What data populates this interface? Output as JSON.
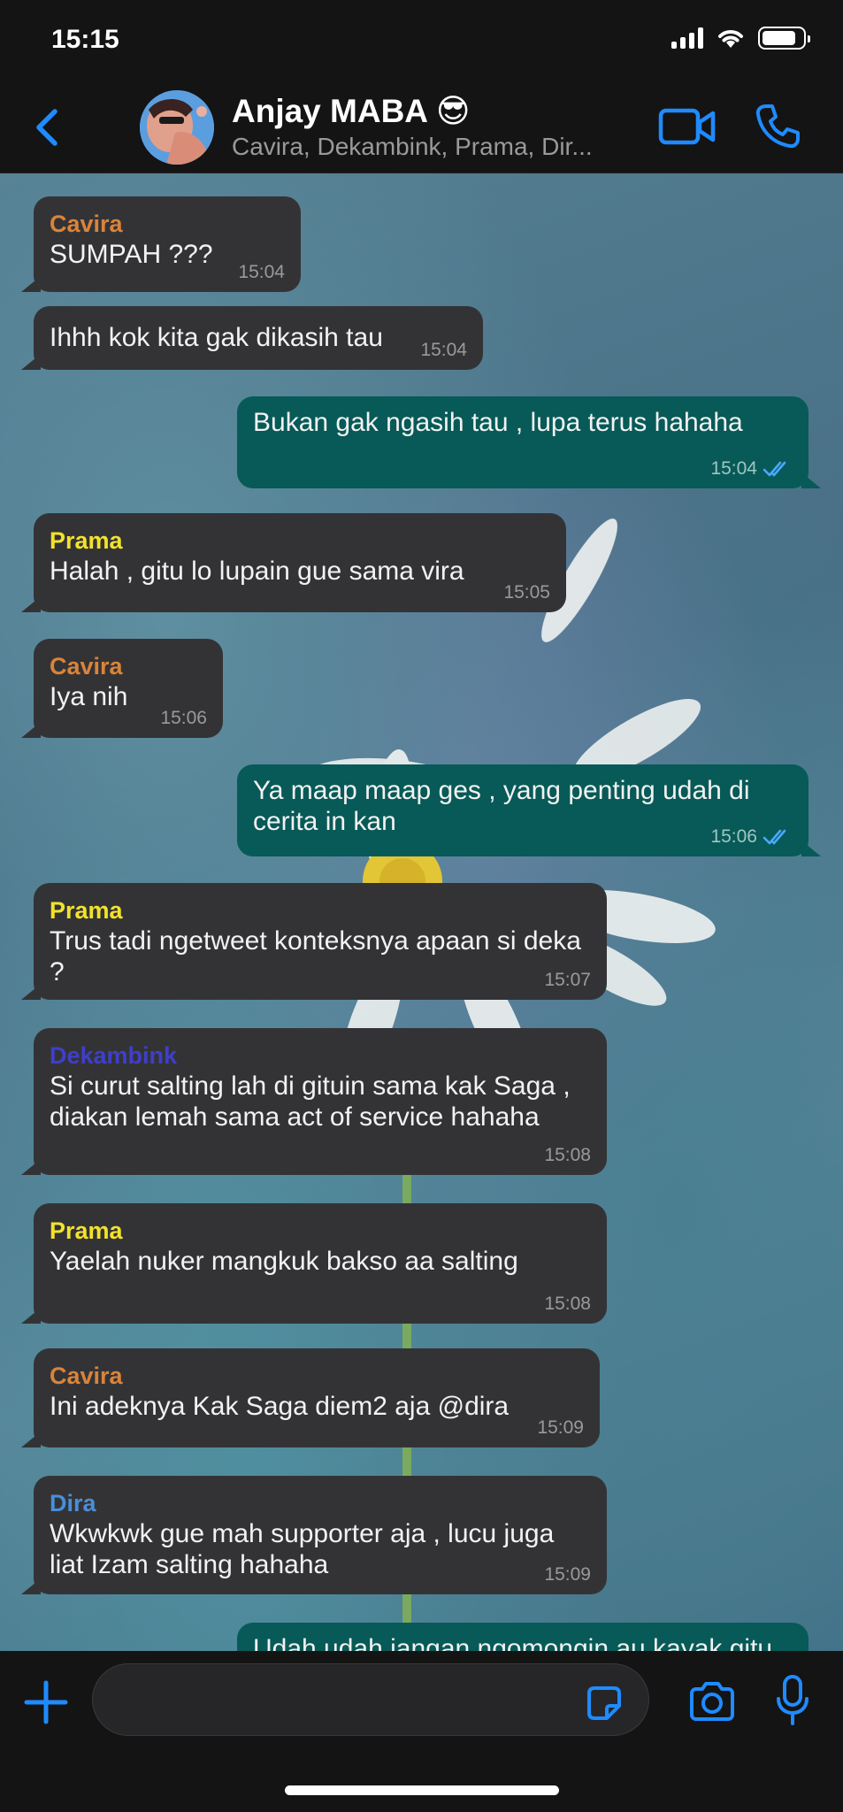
{
  "status_bar": {
    "time": "15:15",
    "battery_level": 0.85
  },
  "header": {
    "title": "Anjay MABA 😎",
    "members": "Cavira, Dekambink, Prama, Dir...",
    "icons": {
      "back": "chevron-left-icon",
      "video": "video-camera-icon",
      "call": "phone-icon"
    }
  },
  "colors": {
    "accent": "#1f8bff",
    "incoming_bubble": "#333336",
    "outgoing_bubble": "#075a57",
    "sender_cavira": "#d9843a",
    "sender_prama": "#f2e22b",
    "sender_dekambink": "#3f3fc9",
    "sender_dira": "#4a8ed8"
  },
  "messages": [
    {
      "direction": "in",
      "sender": "Cavira",
      "text": "SUMPAH ???",
      "time": "15:04"
    },
    {
      "direction": "in",
      "sender": "",
      "text": "Ihhh kok kita gak dikasih tau",
      "time": "15:04"
    },
    {
      "direction": "out",
      "text": "Bukan gak ngasih tau , lupa terus hahaha",
      "time": "15:04",
      "read": true
    },
    {
      "direction": "in",
      "sender": "Prama",
      "text": "Halah , gitu lo lupain gue sama vira",
      "time": "15:05"
    },
    {
      "direction": "in",
      "sender": "Cavira",
      "text": "Iya nih",
      "time": "15:06"
    },
    {
      "direction": "out",
      "text": "Ya maap maap ges , yang penting udah di cerita in kan",
      "time": "15:06",
      "read": true
    },
    {
      "direction": "in",
      "sender": "Prama",
      "text": "Trus tadi ngetweet konteksnya apaan si deka ?",
      "time": "15:07"
    },
    {
      "direction": "in",
      "sender": "Dekambink",
      "text": "Si curut salting lah di gituin sama kak Saga , diakan lemah sama act of service hahaha",
      "time": "15:08"
    },
    {
      "direction": "in",
      "sender": "Prama",
      "text": "Yaelah nuker mangkuk bakso aa salting",
      "time": "15:08"
    },
    {
      "direction": "in",
      "sender": "Cavira",
      "text": "Ini adeknya Kak Saga diem2 aja @dira",
      "time": "15:09"
    },
    {
      "direction": "in",
      "sender": "Dira",
      "text": "Wkwkwk gue mah supporter aja , lucu juga liat Izam salting hahaha",
      "time": "15:09"
    },
    {
      "direction": "out",
      "text": "Udah udah jangan ngomongin au kayak gitu",
      "time": "",
      "read": false
    }
  ],
  "input_bar": {
    "value": "",
    "icons": {
      "add": "plus-icon",
      "sticker": "sticker-icon",
      "camera": "camera-icon",
      "mic": "microphone-icon"
    }
  }
}
